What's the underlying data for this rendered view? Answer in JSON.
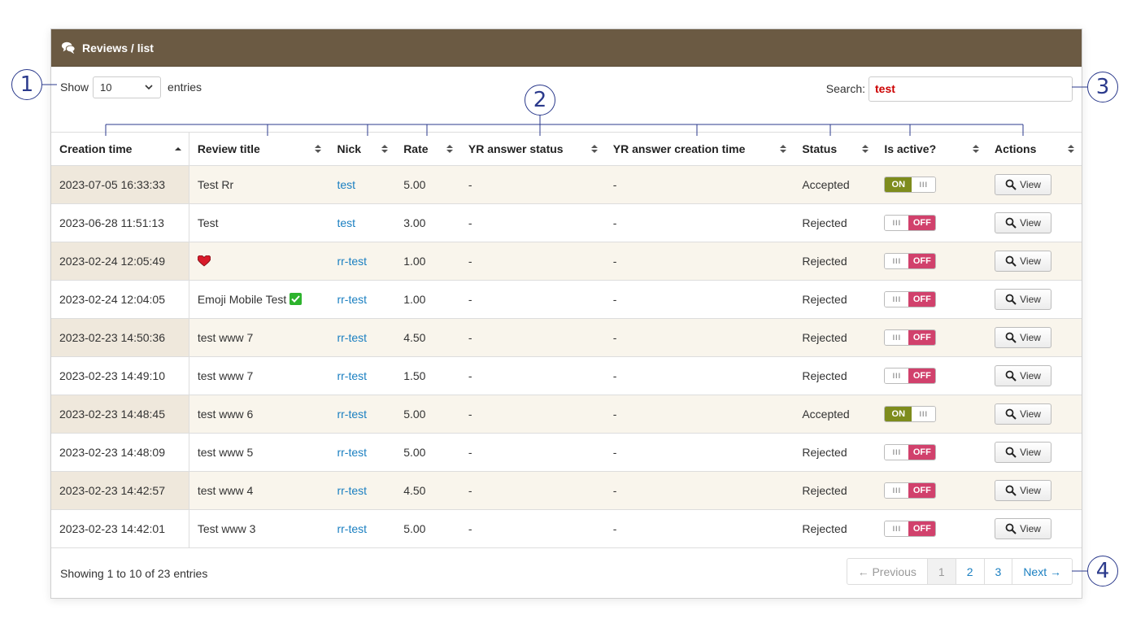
{
  "header": {
    "title": "Reviews / list",
    "icon": "chat-bubbles-icon"
  },
  "length_menu": {
    "show_label": "Show",
    "value": "10",
    "entries_label": "entries"
  },
  "search": {
    "label": "Search:",
    "value": "test"
  },
  "columns": [
    "Creation time",
    "Review title",
    "Nick",
    "Rate",
    "YR answer status",
    "YR answer creation time",
    "Status",
    "Is active?",
    "Actions"
  ],
  "rows": [
    {
      "created": "2023-07-05 16:33:33",
      "title": "Test Rr",
      "nick": "test",
      "rate": "5.00",
      "yr_status": "-",
      "yr_time": "-",
      "status": "Accepted",
      "active": true
    },
    {
      "created": "2023-06-28 11:51:13",
      "title": "Test",
      "nick": "test",
      "rate": "3.00",
      "yr_status": "-",
      "yr_time": "-",
      "status": "Rejected",
      "active": false
    },
    {
      "created": "2023-02-24 12:05:49",
      "title": "",
      "title_icon": "heart-icon",
      "nick": "rr-test",
      "rate": "1.00",
      "yr_status": "-",
      "yr_time": "-",
      "status": "Rejected",
      "active": false
    },
    {
      "created": "2023-02-24 12:04:05",
      "title": "Emoji Mobile Test",
      "title_icon": "check-mark-icon",
      "nick": "rr-test",
      "rate": "1.00",
      "yr_status": "-",
      "yr_time": "-",
      "status": "Rejected",
      "active": false
    },
    {
      "created": "2023-02-23 14:50:36",
      "title": "test www 7",
      "nick": "rr-test",
      "rate": "4.50",
      "yr_status": "-",
      "yr_time": "-",
      "status": "Rejected",
      "active": false
    },
    {
      "created": "2023-02-23 14:49:10",
      "title": "test www 7",
      "nick": "rr-test",
      "rate": "1.50",
      "yr_status": "-",
      "yr_time": "-",
      "status": "Rejected",
      "active": false
    },
    {
      "created": "2023-02-23 14:48:45",
      "title": "test www 6",
      "nick": "rr-test",
      "rate": "5.00",
      "yr_status": "-",
      "yr_time": "-",
      "status": "Accepted",
      "active": true
    },
    {
      "created": "2023-02-23 14:48:09",
      "title": "test www 5",
      "nick": "rr-test",
      "rate": "5.00",
      "yr_status": "-",
      "yr_time": "-",
      "status": "Rejected",
      "active": false
    },
    {
      "created": "2023-02-23 14:42:57",
      "title": "test www 4",
      "nick": "rr-test",
      "rate": "4.50",
      "yr_status": "-",
      "yr_time": "-",
      "status": "Rejected",
      "active": false
    },
    {
      "created": "2023-02-23 14:42:01",
      "title": "Test www 3",
      "nick": "rr-test",
      "rate": "5.00",
      "yr_status": "-",
      "yr_time": "-",
      "status": "Rejected",
      "active": false
    }
  ],
  "toggle": {
    "on_label": "ON",
    "off_label": "OFF",
    "grip": "III",
    "on_color": "#7e8c1d",
    "off_color": "#d1416c"
  },
  "view_label": "View",
  "footer": {
    "info": "Showing 1 to 10 of 23 entries"
  },
  "pagination": {
    "previous": "← Previous",
    "pages": [
      "1",
      "2",
      "3"
    ],
    "next": "Next →",
    "current": "1"
  },
  "callouts": [
    "1",
    "2",
    "3",
    "4"
  ],
  "colors": {
    "header_bg": "#6b5a43",
    "link": "#1a7fc1",
    "search_text": "#cc0000",
    "callout": "#2b3a8c"
  }
}
